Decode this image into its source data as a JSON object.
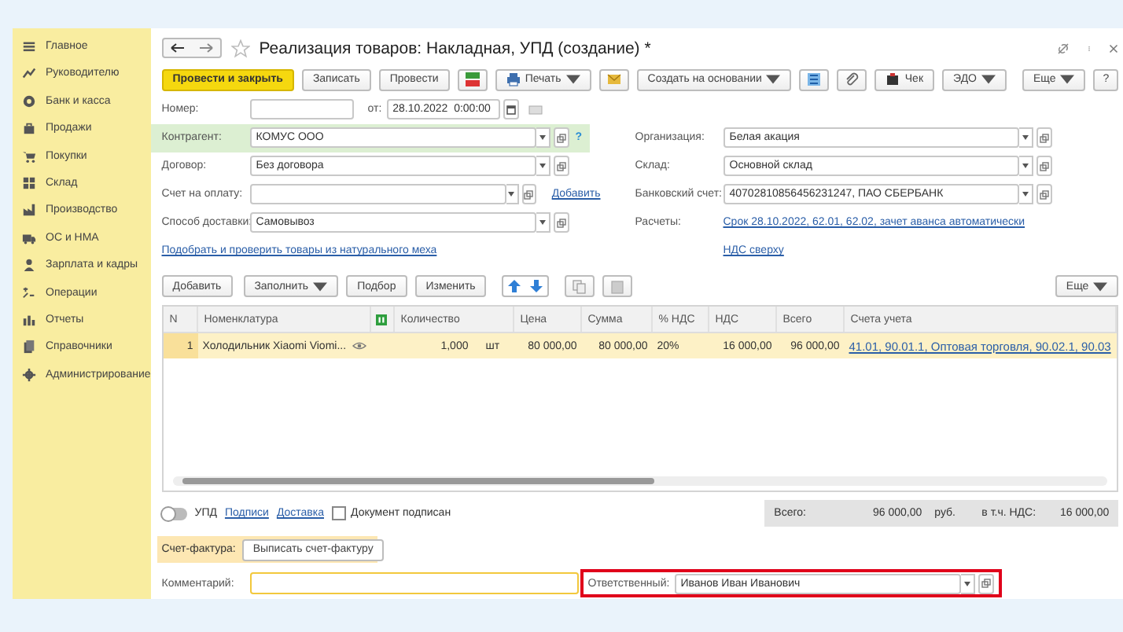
{
  "sidebar": {
    "items": [
      "Главное",
      "Руководителю",
      "Банк и касса",
      "Продажи",
      "Покупки",
      "Склад",
      "Производство",
      "ОС и НМА",
      "Зарплата и кадры",
      "Операции",
      "Отчеты",
      "Справочники",
      "Администрирование"
    ]
  },
  "window": {
    "title": "Реализация товаров: Накладная, УПД (создание) *"
  },
  "toolbar": [
    {
      "kind": "primary",
      "label": "Провести и закрыть"
    },
    {
      "kind": "plain",
      "label": "Записать"
    },
    {
      "kind": "plain",
      "label": "Провести"
    },
    {
      "kind": "icon"
    },
    {
      "kind": "menu",
      "label": "Печать"
    },
    {
      "kind": "icon"
    },
    {
      "kind": "menu",
      "label": "Создать на основании"
    },
    {
      "kind": "icon"
    },
    {
      "kind": "icon"
    },
    {
      "kind": "plain",
      "label": "Чек"
    },
    {
      "kind": "menu",
      "label": "ЭДО"
    }
  ],
  "more_label": "Еще",
  "help_label": "?",
  "number": {
    "label": "Номер:",
    "from_label": "от:",
    "date": "28.10.2022  0:00:00"
  },
  "left_fields": [
    {
      "label": "Контрагент:",
      "value": "КОМУС ООО",
      "highlighted": true,
      "help": "?"
    },
    {
      "label": "Договор:",
      "value": "Без договора",
      "highlighted": false
    },
    {
      "label": "Счет на оплату:",
      "highlighted": false,
      "link": "Добавить"
    },
    {
      "label": "Способ доставки:",
      "value": "Самовывоз",
      "highlighted": false
    }
  ],
  "right_fields": [
    {
      "label": "Организация:",
      "value": "Белая акация"
    },
    {
      "label": "Склад:",
      "value": "Основной склад"
    },
    {
      "label": "Банковский счет:",
      "value": "40702810856456231247, ПАО СБЕРБАНК"
    }
  ],
  "settlements": {
    "label": "Расчеты:",
    "link": "Срок 28.10.2022, 62.01, 62.02, зачет аванса автоматически",
    "vat_link": "НДС сверху"
  },
  "fur_link": "Подобрать и проверить товары из натурального меха",
  "table_toolbar": [
    {
      "kind": "plain",
      "label": "Добавить"
    },
    {
      "kind": "menu",
      "label": "Заполнить"
    },
    {
      "kind": "plain",
      "label": "Подбор"
    },
    {
      "kind": "plain",
      "label": "Изменить"
    }
  ],
  "table_more": "Еще",
  "table": {
    "columns": [
      "N",
      "Номенклатура",
      "",
      "Количество",
      "Цена",
      "Сумма",
      "% НДС",
      "НДС",
      "Всего",
      "Счета учета"
    ],
    "rows": [
      {
        "n": "1",
        "item": "Холодильник Xiaomi Viomi...",
        "quantity": "1,000",
        "unit": "шт",
        "price": "80 000,00",
        "sum": "80 000,00",
        "vat_rate": "20%",
        "vat": "16 000,00",
        "total": "96 000,00",
        "accounts": "41.01, 90.01.1, Оптовая торговля, 90.02.1, 90.03",
        "selected": true
      }
    ]
  },
  "footer": {
    "upd": {
      "label": "УПД",
      "on": false
    },
    "links": [
      "Подписи",
      "Доставка"
    ],
    "signed": {
      "label": "Документ подписан",
      "checked": false
    },
    "total_label": "Всего:",
    "total": "96 000,00",
    "currency": "руб.",
    "vat_label": "в т.ч. НДС:",
    "vat": "16 000,00"
  },
  "invoice": {
    "label": "Счет-фактура:",
    "button": "Выписать счет-фактуру"
  },
  "comment": {
    "label": "Комментарий:"
  },
  "responsible": {
    "label": "Ответственный:",
    "value": "Иванов Иван Иванович",
    "highlighted": true
  }
}
